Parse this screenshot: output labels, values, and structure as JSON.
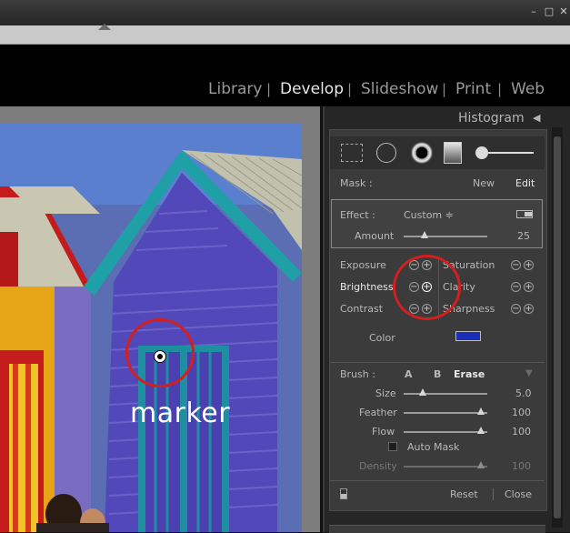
{
  "window": {
    "minimize": "–",
    "maximize": "□",
    "close": "✕"
  },
  "modules": [
    "Library",
    "Develop",
    "Slideshow",
    "Print",
    "Web"
  ],
  "module_separator": "|",
  "panel": {
    "title": "Histogram",
    "collapse_glyph": "◀",
    "mask": {
      "label": "Mask :",
      "new": "New",
      "edit": "Edit"
    },
    "effect": {
      "label": "Effect :",
      "value": "Custom ≑",
      "amount_label": "Amount",
      "amount_value": "25",
      "amount_fraction": 0.25
    },
    "adjustments": [
      {
        "left": "Exposure",
        "right": "Saturation"
      },
      {
        "left": "Brightness",
        "right": "Clarity"
      },
      {
        "left": "Contrast",
        "right": "Sharpness"
      }
    ],
    "color_label": "Color",
    "color_swatch": "#1a2fb8",
    "brush": {
      "label": "Brush :",
      "a": "A",
      "b": "B",
      "erase": "Erase",
      "size_label": "Size",
      "size_value": "5.0",
      "feather_label": "Feather",
      "feather_value": "100",
      "flow_label": "Flow",
      "flow_value": "100",
      "auto_mask": "Auto Mask",
      "density_label": "Density",
      "density_value": "100"
    },
    "reset": "Reset",
    "close": "Close"
  },
  "annotation": {
    "marker_text": "marker",
    "ring_color": "#d21f1f"
  }
}
